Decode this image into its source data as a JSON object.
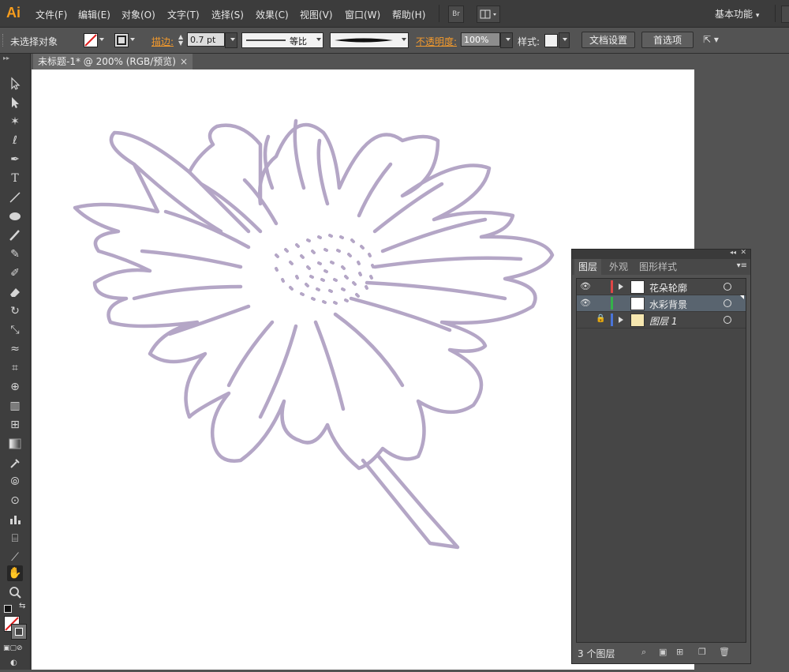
{
  "app": {
    "logo": "Ai"
  },
  "menu": [
    "文件(F)",
    "编辑(E)",
    "对象(O)",
    "文字(T)",
    "选择(S)",
    "效果(C)",
    "视图(V)",
    "窗口(W)",
    "帮助(H)"
  ],
  "workspace_label": "基本功能",
  "bridge_label": "Br",
  "control": {
    "selection": "未选择对象",
    "stroke_label": "描边:",
    "stroke_weight": "0.7 pt",
    "profile_label": "等比",
    "opacity_label": "不透明度:",
    "opacity_value": "100%",
    "style_label": "样式:",
    "doc_setup": "文档设置",
    "prefs": "首选项"
  },
  "document_tab": {
    "title": "未标题-1* @ 200% (RGB/预览)",
    "close": "×"
  },
  "layers_panel": {
    "tabs": [
      "图层",
      "外观",
      "图形样式"
    ],
    "layers": [
      {
        "name": "花朵轮廓",
        "color": "#e04646",
        "visible": true,
        "locked": false,
        "selected": false,
        "expandable": true
      },
      {
        "name": "水彩背景",
        "color": "#35b24a",
        "visible": true,
        "locked": false,
        "selected": true,
        "expandable": false
      },
      {
        "name": "图层 1",
        "color": "#4a74d9",
        "visible": false,
        "locked": true,
        "selected": false,
        "expandable": true
      }
    ],
    "footer_count": "3 个图层"
  },
  "colors": {
    "flower_stroke": "#b4a6c6",
    "app_bg": "#535353",
    "menubar": "#3c3c3c"
  }
}
